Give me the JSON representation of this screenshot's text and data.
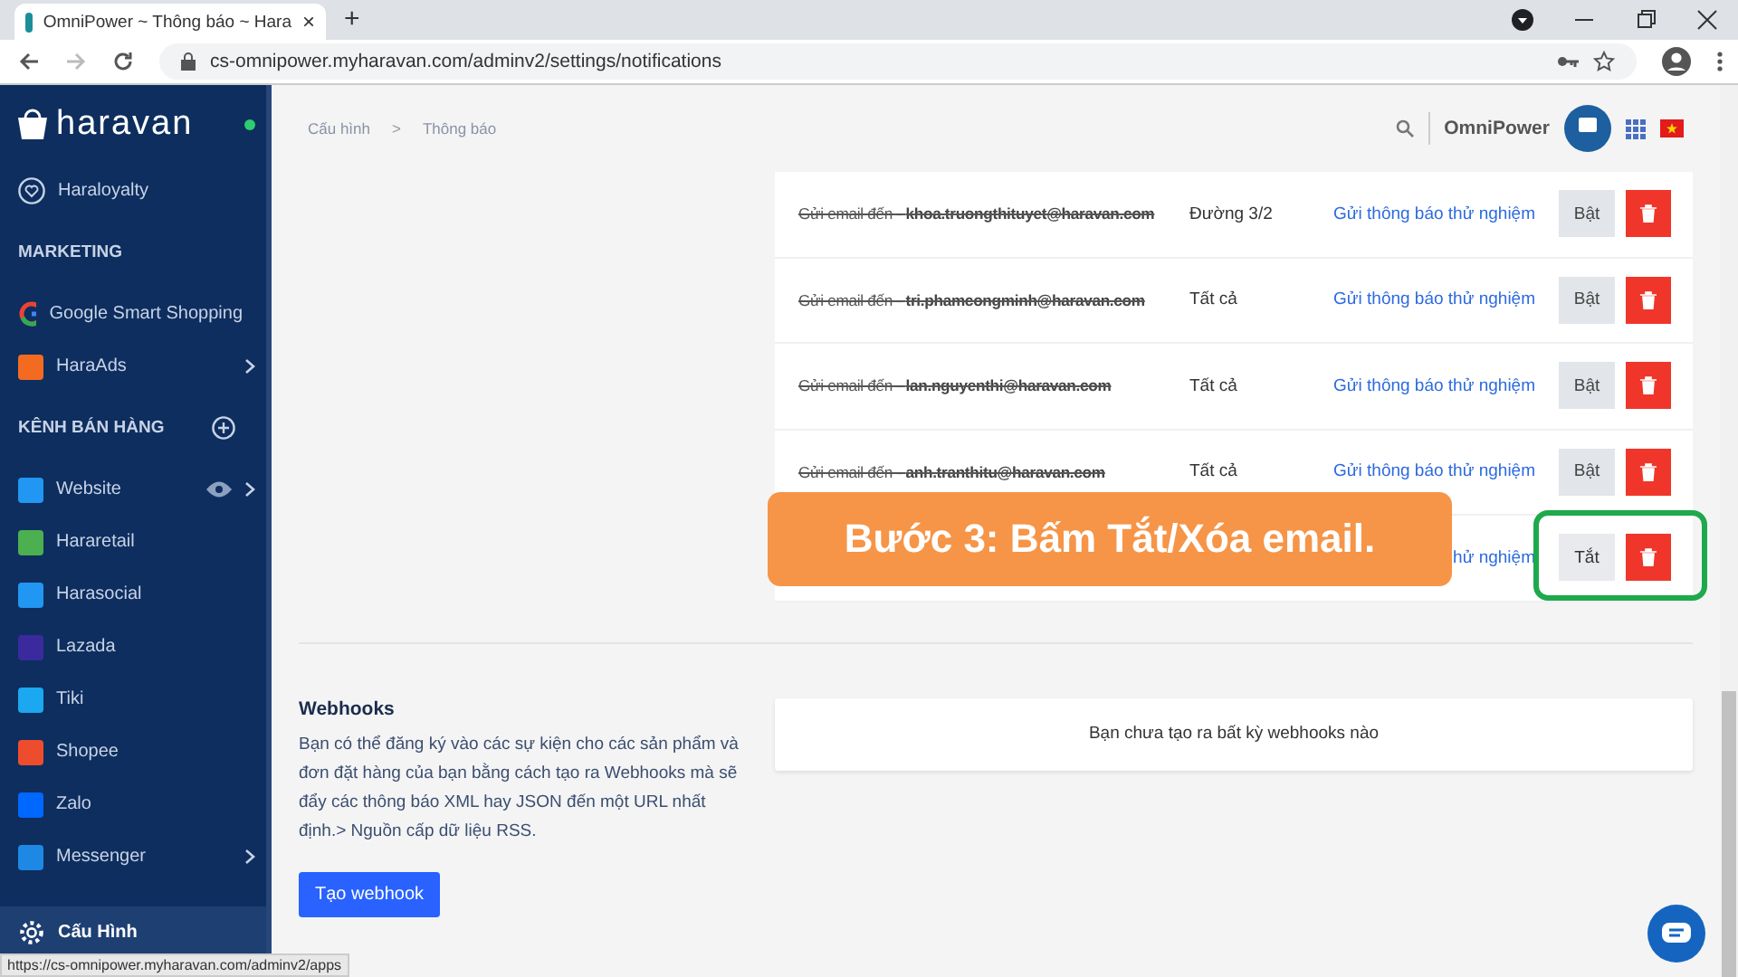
{
  "browser": {
    "tab_title": "OmniPower ~ Thông báo ~ Hara",
    "tab_close": "×",
    "new_tab": "+",
    "url": "cs-omnipower.myharavan.com/adminv2/settings/notifications"
  },
  "sidebar": {
    "logo": "haravan",
    "online": true,
    "items": [
      {
        "kind": "item",
        "label": "Haraloyalty",
        "selected": false
      },
      {
        "kind": "section",
        "label": "MARKETING"
      },
      {
        "kind": "item",
        "label": "Google Smart Shopping",
        "selected": false
      },
      {
        "kind": "item",
        "label": "HaraAds",
        "chevron": true,
        "selected": false
      },
      {
        "kind": "section",
        "label": "KÊNH BÁN HÀNG",
        "add": true
      },
      {
        "kind": "item",
        "label": "Website",
        "chevron": true,
        "eye": true,
        "selected": false
      },
      {
        "kind": "item",
        "label": "Hararetail",
        "selected": false
      },
      {
        "kind": "item",
        "label": "Harasocial",
        "selected": false
      },
      {
        "kind": "item",
        "label": "Lazada",
        "selected": false
      },
      {
        "kind": "item",
        "label": "Tiki",
        "selected": false
      },
      {
        "kind": "item",
        "label": "Shopee",
        "selected": false
      },
      {
        "kind": "item",
        "label": "Zalo",
        "selected": false
      },
      {
        "kind": "item",
        "label": "Messenger",
        "chevron": true,
        "selected": false
      },
      {
        "kind": "item",
        "label": "Cấu Hình",
        "selected": true
      }
    ]
  },
  "header": {
    "breadcrumb": [
      "Cấu hình",
      "Thông báo"
    ],
    "separator": ">",
    "store": "OmniPower"
  },
  "recipients": [
    {
      "email": "Gửi email đến - **khoa.truongthituyet@haravan.com**",
      "filter": "Đường 3/2",
      "link": "Gửi thông báo thử nghiệm",
      "toggle": "Bật",
      "on": false,
      "highlight": false
    },
    {
      "email": "Gửi email đến - **tri.phamcongminh@haravan.com**",
      "filter": "Tất cả",
      "link": "Gửi thông báo thử nghiệm",
      "toggle": "Bật",
      "on": false,
      "highlight": false
    },
    {
      "email": "Gửi email đến - **lan.nguyenthi@haravan.com**",
      "filter": "Tất cả",
      "link": "Gửi thông báo thử nghiệm",
      "toggle": "Bật",
      "on": false,
      "highlight": false
    },
    {
      "email": "Gửi email đến - **anh.tranthitu@haravan.com**",
      "filter": "Tất cả",
      "link": "Gửi thông báo thử nghiệm",
      "toggle": "Bật",
      "on": false,
      "highlight": false
    },
    {
      "link": "hử nghiệm",
      "toggle": "Tắt",
      "on": true,
      "highlight": true
    }
  ],
  "callout": "Bước 3: Bấm Tắt/Xóa email.",
  "webhooks": {
    "title": "Webhooks",
    "description": "Bạn có thể đăng ký vào các sự kiện cho các sản phẩm và đơn đặt hàng của bạn bằng cách tạo ra Webhooks mà sẽ đẩy các thông báo XML hay JSON đến một URL nhất định.> Nguồn cấp dữ liệu RSS.",
    "button": "Tạo webhook",
    "empty": "Bạn chưa tạo ra bất kỳ webhooks nào"
  },
  "status_url": "https://cs-omnipower.myharavan.com/adminv2/apps"
}
